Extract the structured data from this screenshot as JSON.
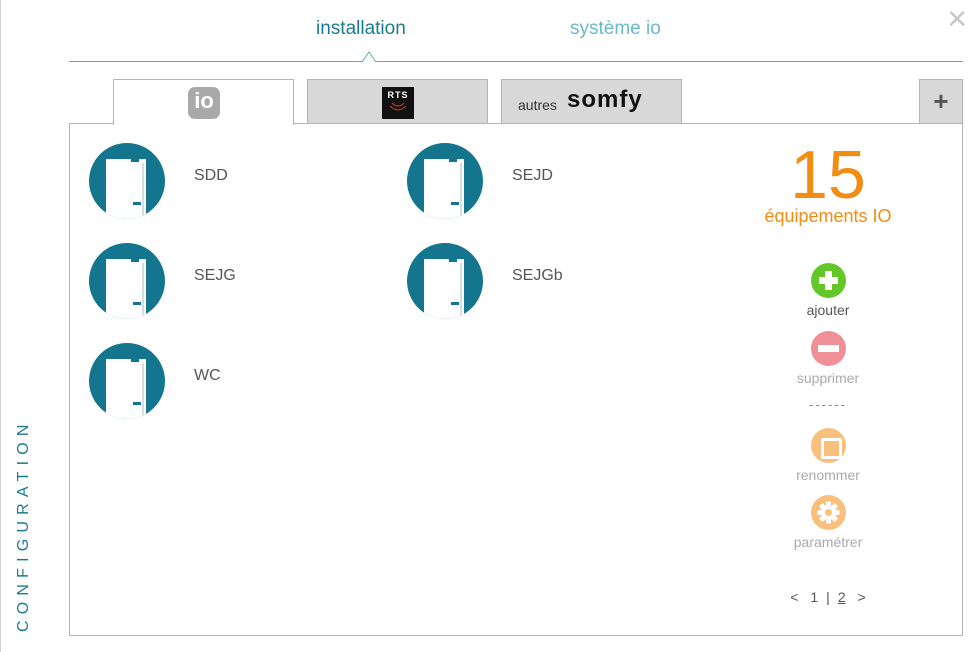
{
  "window": {
    "close_label": "✕",
    "side_title": "CONFIGURATION"
  },
  "top_tabs": [
    {
      "label": "installation",
      "active": true
    },
    {
      "label": "système io",
      "active": false
    }
  ],
  "sub_tabs": {
    "io": {
      "logo_text": "io"
    },
    "rts": {
      "logo_text": "RTS"
    },
    "somfy": {
      "prefix": "autres",
      "brand": "somfy"
    },
    "add_label": "+"
  },
  "devices": [
    {
      "name": "SDD"
    },
    {
      "name": "SEJD"
    },
    {
      "name": "SEJG"
    },
    {
      "name": "SEJGb"
    },
    {
      "name": "WC"
    }
  ],
  "summary": {
    "count": "15",
    "label": "équipements IO"
  },
  "actions": {
    "add": {
      "label": "ajouter",
      "color": "#63c629"
    },
    "delete": {
      "label": "supprimer",
      "color": "#ef8f96"
    },
    "divider": "------",
    "rename": {
      "label": "renommer",
      "color": "#f9c07d"
    },
    "settings": {
      "label": "paramétrer",
      "color": "#f9c07d"
    }
  },
  "pagination": {
    "prev": "<",
    "page1": "1",
    "sep": "|",
    "page2": "2",
    "next": ">"
  },
  "colors": {
    "accent": "#14768e",
    "orange": "#f28c12",
    "text_muted": "#555555"
  }
}
